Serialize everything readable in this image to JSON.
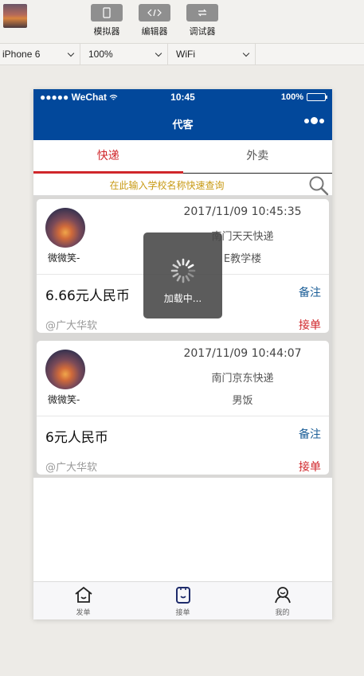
{
  "ide": {
    "tools": [
      {
        "label": "模拟器",
        "icon": "phone-icon"
      },
      {
        "label": "编辑器",
        "icon": "code-icon"
      },
      {
        "label": "调试器",
        "icon": "debug-icon"
      }
    ],
    "device": "iPhone 6",
    "zoom": "100%",
    "network": "WiFi"
  },
  "status": {
    "carrier": "●●●●● WeChat",
    "time": "10:45",
    "battery": "100%"
  },
  "nav": {
    "title": "代客"
  },
  "tabs": [
    {
      "label": "快递",
      "active": true
    },
    {
      "label": "外卖",
      "active": false
    }
  ],
  "search": {
    "placeholder": "在此输入学校名称快速查询"
  },
  "orders": [
    {
      "user": "微微笑-",
      "time": "2017/11/09 10:45:35",
      "from": "南门天天快递",
      "to": "E教学楼",
      "price": "6.66元人民币",
      "note_label": "备注",
      "org": "@广大华软",
      "accept_label": "接单"
    },
    {
      "user": "微微笑-",
      "time": "2017/11/09 10:44:07",
      "from": "南门京东快递",
      "to": "男饭",
      "price": "6元人民币",
      "note_label": "备注",
      "org": "@广大华软",
      "accept_label": "接单"
    }
  ],
  "tabbar": [
    {
      "label": "发单",
      "icon": "home-icon"
    },
    {
      "label": "接单",
      "icon": "clipboard-icon"
    },
    {
      "label": "我的",
      "icon": "profile-icon"
    }
  ],
  "toast": {
    "message": "加载中..."
  },
  "colors": {
    "primary": "#02489b",
    "accent": "#d0272b",
    "link": "#1b5e97",
    "placeholder": "#c89a14"
  }
}
